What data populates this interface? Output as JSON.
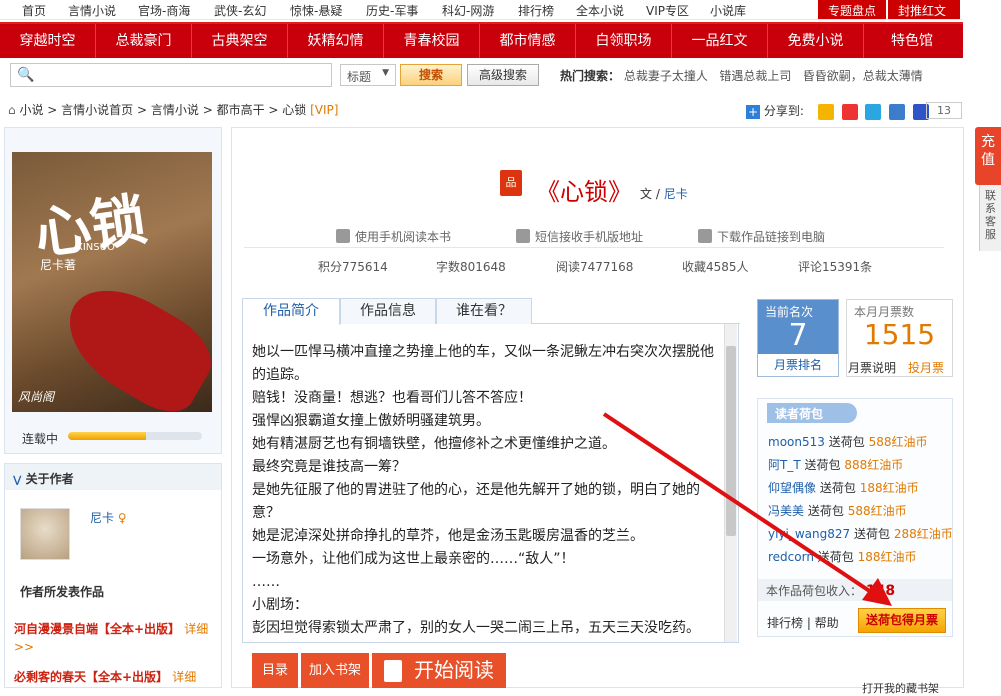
{
  "topnav": {
    "items": [
      "首页",
      "言情小说",
      "官场-商海",
      "武侠-玄幻",
      "惊悚-悬疑",
      "历史-军事",
      "科幻-网游",
      "排行榜",
      "全本小说",
      "VIP专区",
      "小说库"
    ],
    "right": [
      "专题盘点",
      "封推红文"
    ]
  },
  "channels": [
    "穿越时空",
    "总裁豪门",
    "古典架空",
    "妖精幻情",
    "青春校园",
    "都市情感",
    "白领职场",
    "一品红文",
    "免费小说",
    "特色馆"
  ],
  "search": {
    "placeholder": "",
    "select": "标题",
    "button": "搜索",
    "advanced": "高级搜索",
    "hot_label": "热门搜索：",
    "hot": [
      "总裁妻子太撞人",
      "错遇总裁上司",
      "昏昏欲嗣，总裁太薄情"
    ]
  },
  "breadcrumb": {
    "items": [
      "小说",
      "言情小说首页",
      "言情小说",
      "都市高干",
      "心锁"
    ],
    "vip": "[VIP]"
  },
  "share": {
    "label": "分享到:",
    "count": "13"
  },
  "cover": {
    "title": "心锁",
    "pinyin": "XINSUO",
    "author": "尼卡著",
    "publisher": "风尚阁"
  },
  "serial": {
    "label": "连载中",
    "progress": 0.58
  },
  "author": {
    "header": "关于作者",
    "name": "尼卡",
    "works_title": "作者所发表作品",
    "works": [
      {
        "title": "河自漫漫景自端【全本+出版】",
        "more": "详细>>"
      },
      {
        "title": "必剩客的春天【全本+出版】",
        "more": "详细"
      }
    ]
  },
  "book": {
    "title": "《心锁》",
    "by": "文 /",
    "author": "尼卡",
    "icon_text": "品",
    "actions": [
      "使用手机阅读本书",
      "短信接收手机版地址",
      "下载作品链接到电脑"
    ],
    "stats": [
      "积分775614",
      "字数801648",
      "阅读7477168",
      "收藏4585人",
      "评论15391条"
    ]
  },
  "tabs": [
    "作品简介",
    "作品信息",
    "谁在看？"
  ],
  "intro": [
    "她以一匹悍马横冲直撞之势撞上他的车，又似一条泥鳅左冲右突次次摆脱他的追踪。",
    "赔钱！没商量！想逃？也看哥们儿答不答应！",
    "强悍凶狠霸道女撞上傲娇明骚建筑男。",
    "她有精湛厨艺也有铜墙铁壁，他擅修补之术更懂维护之道。",
    "最终究竟是谁技高一筹？",
    "是她先征服了他的胃进驻了他的心，还是他先解开了她的锁，明白了她的意？",
    "她是泥淖深处拼命挣扎的草芥，他是金汤玉匙暖房温香的芝兰。",
    "一场意外，让他们成为这世上最亲密的……“敌人”！",
    "……",
    "小剧场：",
    "彭因坦觉得索锁太严肃了，别的女人一哭二闹三上吊，五天三天没吃药。"
  ],
  "buttons": {
    "dir": "目录",
    "shelf": "加入书架",
    "read": "开始阅读"
  },
  "rank": {
    "label": "当前名次",
    "num": "7",
    "btn": "月票排名"
  },
  "month": {
    "label": "本月月票数",
    "num": "1515",
    "help": "月票说明",
    "vote": "投月票"
  },
  "pouch": {
    "header": "读者荷包",
    "rows": [
      {
        "user": "moon513",
        "act": "送荷包",
        "gift": "588红油币"
      },
      {
        "user": "阿T_T",
        "act": "送荷包",
        "gift": "888红油币"
      },
      {
        "user": "仰望偶像",
        "act": "送荷包",
        "gift": "188红油币"
      },
      {
        "user": "冯美美",
        "act": "送荷包",
        "gift": "588红油币"
      },
      {
        "user": "yiyi_wang827",
        "act": "送荷包",
        "gift": "288红油币"
      },
      {
        "user": "redcorn",
        "act": "送荷包",
        "gift": "188红油币"
      }
    ],
    "total_label": "本作品荷包收入：",
    "total": "148",
    "rank_help": "排行榜 | 帮助",
    "button": "送荷包得月票"
  },
  "side": {
    "recharge": "充值",
    "service": "联系客服"
  },
  "open_shelf": "打开我的藏书架"
}
